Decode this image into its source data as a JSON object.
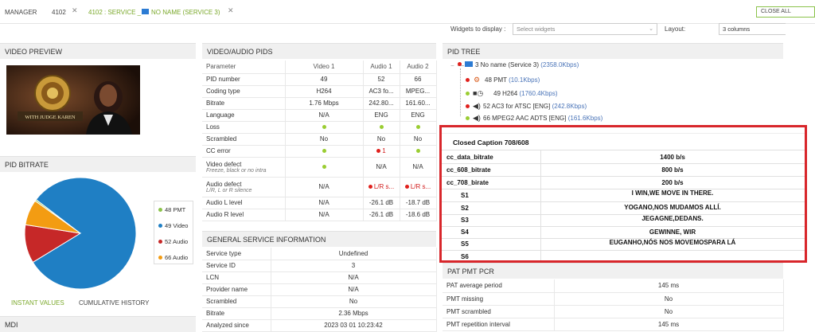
{
  "topbar": {
    "crumb_manager": "MANAGER",
    "crumb_4102": "4102",
    "crumb_service_prefix": "4102 : SERVICE _",
    "crumb_service_name": "NO NAME (SERVICE 3)",
    "close_all": "CLOSE ALL"
  },
  "widgets": {
    "display_label": "Widgets to display :",
    "select_placeholder": "Select widgets",
    "layout_label": "Layout:",
    "layout_value": "3 columns"
  },
  "video_preview": {
    "title": "VIDEO PREVIEW",
    "caption": "WITH JUDGE KAREN"
  },
  "pid_bitrate": {
    "title": "PID BITRATE",
    "legend": [
      {
        "label": "48 PMT",
        "color": "#8bc34a"
      },
      {
        "label": "49 Video",
        "color": "#1f7fc4"
      },
      {
        "label": "52 Audio",
        "color": "#c62828"
      },
      {
        "label": "66 Audio",
        "color": "#f39c12"
      }
    ],
    "tab_instant": "INSTANT VALUES",
    "tab_history": "CUMULATIVE HISTORY",
    "chart_data": {
      "type": "pie",
      "categories": [
        "48 PMT",
        "49 Video",
        "52 Audio",
        "66 Audio"
      ],
      "values": [
        10.1,
        1760.4,
        242.8,
        161.6
      ]
    }
  },
  "mdi": {
    "title": "MDI"
  },
  "av_pids": {
    "title": "VIDEO/AUDIO PIDS",
    "headers": [
      "Parameter",
      "Video 1",
      "Audio 1",
      "Audio 2"
    ],
    "rows": [
      {
        "label": "PID number",
        "v1": "49",
        "a1": "52",
        "a2": "66"
      },
      {
        "label": "Coding type",
        "v1": "H264",
        "a1": "AC3 fo...",
        "a2": "MPEG..."
      },
      {
        "label": "Bitrate",
        "v1": "1.76 Mbps",
        "a1": "242.80...",
        "a2": "161.60..."
      },
      {
        "label": "Language",
        "v1": "N/A",
        "a1": "ENG",
        "a2": "ENG"
      },
      {
        "label": "Loss",
        "v1": "",
        "a1": "",
        "a2": ""
      },
      {
        "label": "Scrambled",
        "v1": "No",
        "a1": "No",
        "a2": "No"
      },
      {
        "label": "CC error",
        "v1": "",
        "a1": "1",
        "a2": ""
      },
      {
        "label": "Video defect",
        "sub": "Freeze, black or no intra",
        "v1": "",
        "a1": "N/A",
        "a2": "N/A"
      },
      {
        "label": "Audio defect",
        "sub": "L/R, L or R silence",
        "v1": "N/A",
        "a1": "L/R s...",
        "a2": "L/R s..."
      },
      {
        "label": "Audio L level",
        "v1": "N/A",
        "a1": "-26.1 dB",
        "a2": "-18.7 dB"
      },
      {
        "label": "Audio R level",
        "v1": "N/A",
        "a1": "-26.1 dB",
        "a2": "-18.6 dB"
      }
    ]
  },
  "general": {
    "title": "GENERAL SERVICE INFORMATION",
    "rows": [
      {
        "label": "Service type",
        "value": "Undefined"
      },
      {
        "label": "Service ID",
        "value": "3"
      },
      {
        "label": "LCN",
        "value": "N/A"
      },
      {
        "label": "Provider name",
        "value": "N/A"
      },
      {
        "label": "Scrambled",
        "value": "No"
      },
      {
        "label": "Bitrate",
        "value": "2.36 Mbps"
      },
      {
        "label": "Analyzed since",
        "value": "2023 03 01 10:23:42"
      }
    ]
  },
  "pid_tree": {
    "title": "PID TREE",
    "root": {
      "label": "3 No name (Service 3)",
      "kbps": "(2358.0Kbps)"
    },
    "children": [
      {
        "label": "48 PMT",
        "kbps": "(10.1Kbps)"
      },
      {
        "label": "49 H264",
        "kbps": "(1760.4Kbps)"
      },
      {
        "label": "52 AC3 for ATSC [ENG]",
        "kbps": "(242.8Kbps)"
      },
      {
        "label": "66 MPEG2 AAC ADTS [ENG]",
        "kbps": "(161.6Kbps)"
      }
    ]
  },
  "closed_caption": {
    "title": "Closed Caption  708/608",
    "rows": [
      {
        "key": "cc_data_bitrate",
        "value": "1400 b/s"
      },
      {
        "key": "cc_608_bitrate",
        "value": "800 b/s"
      },
      {
        "key": "cc_708_birate",
        "value": "200 b/s"
      },
      {
        "key": "S1",
        "value": "I WIN,WE MOVE IN THERE."
      },
      {
        "key": "S2",
        "value": "YOGANO,NOS MUDAMOS ALLÍ."
      },
      {
        "key": "S3",
        "value": "JEGAGNE,DEDANS."
      },
      {
        "key": "S4",
        "value": "GEWINNE, WIR"
      },
      {
        "key": "S5",
        "value": "EUGANHO,NÓS NOS MOVEMOSPARA LÁ"
      },
      {
        "key": "S6",
        "value": ""
      }
    ]
  },
  "pat_pmt": {
    "title": "PAT PMT PCR",
    "rows": [
      {
        "label": "PAT average period",
        "value": "145 ms"
      },
      {
        "label": "PMT missing",
        "value": "No"
      },
      {
        "label": "PMT scrambled",
        "value": "No"
      },
      {
        "label": "PMT repetition interval",
        "value": "145 ms"
      }
    ]
  }
}
